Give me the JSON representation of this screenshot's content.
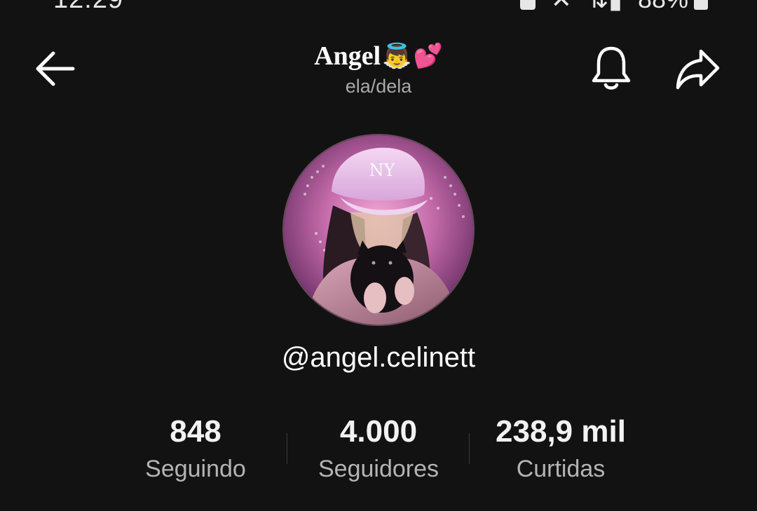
{
  "status_bar": {
    "time": "12:29",
    "battery": "88%"
  },
  "header": {
    "display_name": "Angel",
    "name_emojis": [
      "👼",
      "💕"
    ],
    "pronouns": "ela/dela",
    "icons": {
      "back": "arrow-left-icon",
      "notifications": "bell-icon",
      "share": "share-arrow-icon"
    }
  },
  "profile": {
    "username": "@angel.celinett"
  },
  "stats": [
    {
      "value": "848",
      "label": "Seguindo"
    },
    {
      "value": "4.000",
      "label": "Seguidores"
    },
    {
      "value": "238,9 mil",
      "label": "Curtidas"
    }
  ],
  "colors": {
    "background": "#121212",
    "text_primary": "#ffffff",
    "text_secondary": "#b4b4b4"
  }
}
